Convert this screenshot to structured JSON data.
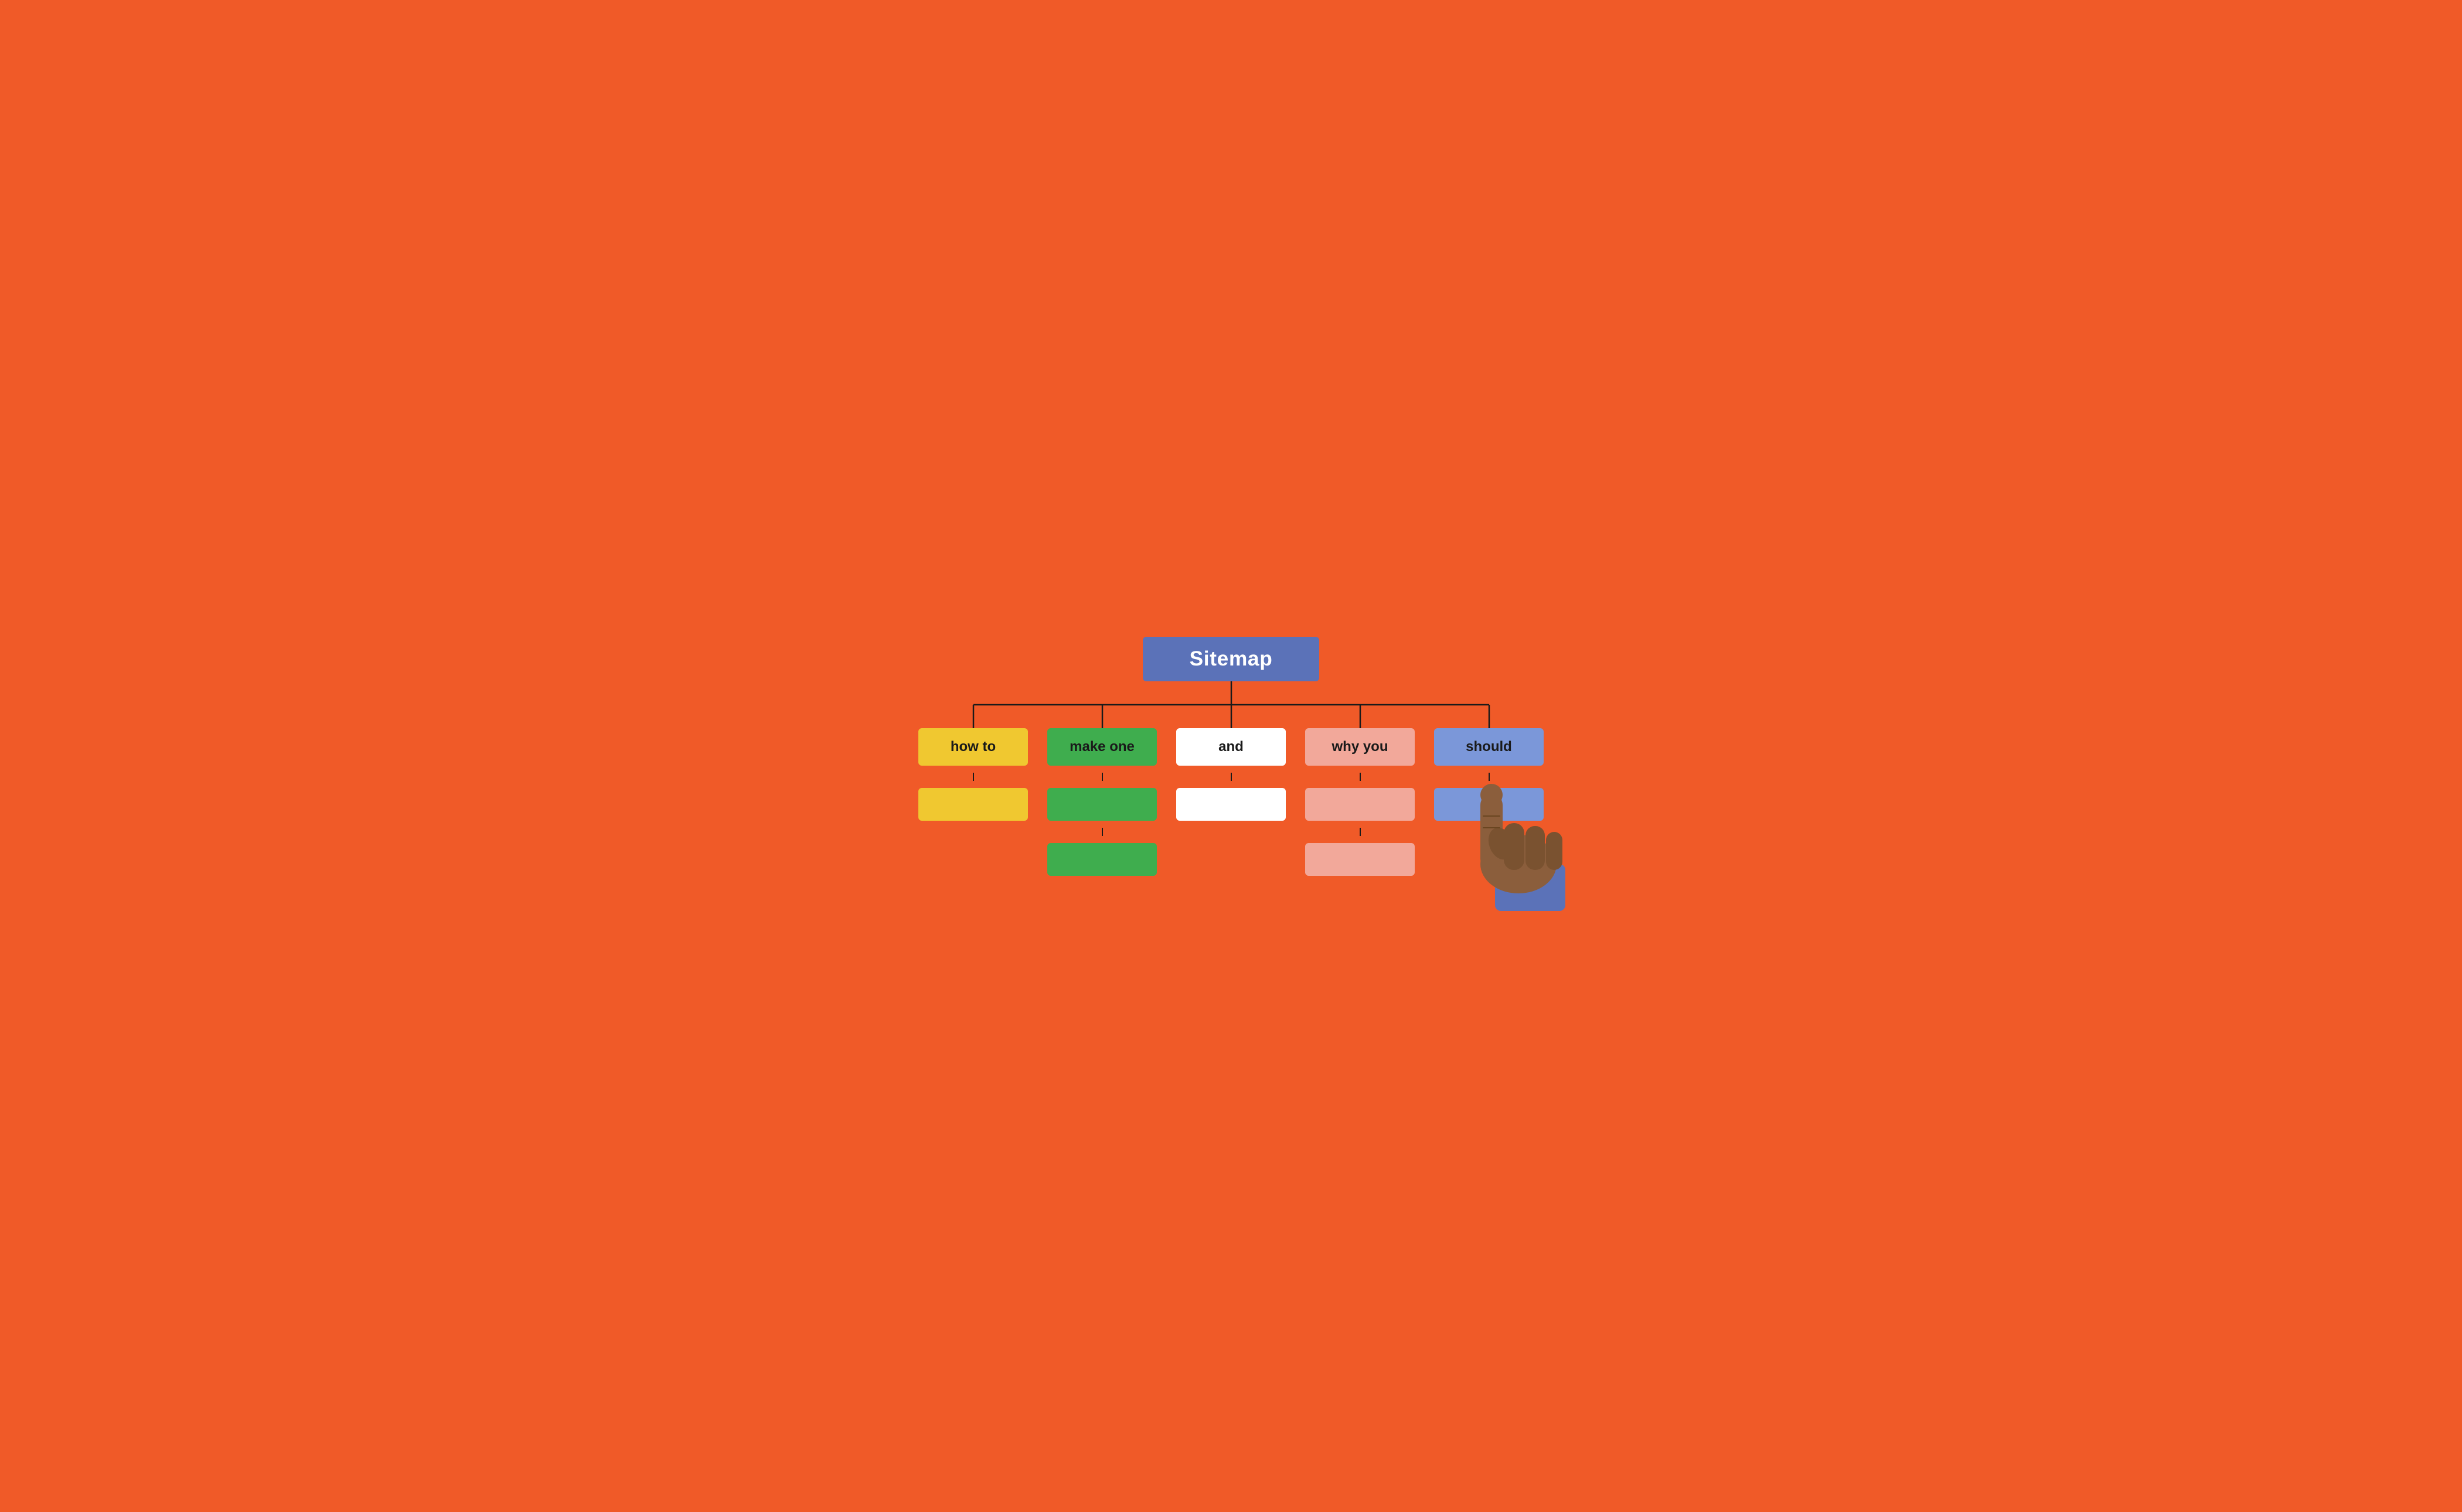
{
  "root": {
    "label": "Sitemap"
  },
  "children": [
    {
      "id": "col-1",
      "label": "how to",
      "sub_nodes": [
        {
          "label": ""
        }
      ]
    },
    {
      "id": "col-2",
      "label": "make one",
      "sub_nodes": [
        {
          "label": ""
        },
        {
          "label": ""
        }
      ]
    },
    {
      "id": "col-3",
      "label": "and",
      "sub_nodes": [
        {
          "label": ""
        }
      ]
    },
    {
      "id": "col-4",
      "label": "why you",
      "sub_nodes": [
        {
          "label": ""
        },
        {
          "label": ""
        }
      ]
    },
    {
      "id": "col-5",
      "label": "should",
      "sub_nodes": [
        {
          "label": ""
        }
      ]
    }
  ],
  "colors": {
    "background": "#F05A28",
    "root_bg": "#5B72B8",
    "col1": "#F0C830",
    "col2": "#3FAD4E",
    "col3": "#FFFFFF",
    "col4": "#F2A89A",
    "col5": "#7B97D9"
  }
}
